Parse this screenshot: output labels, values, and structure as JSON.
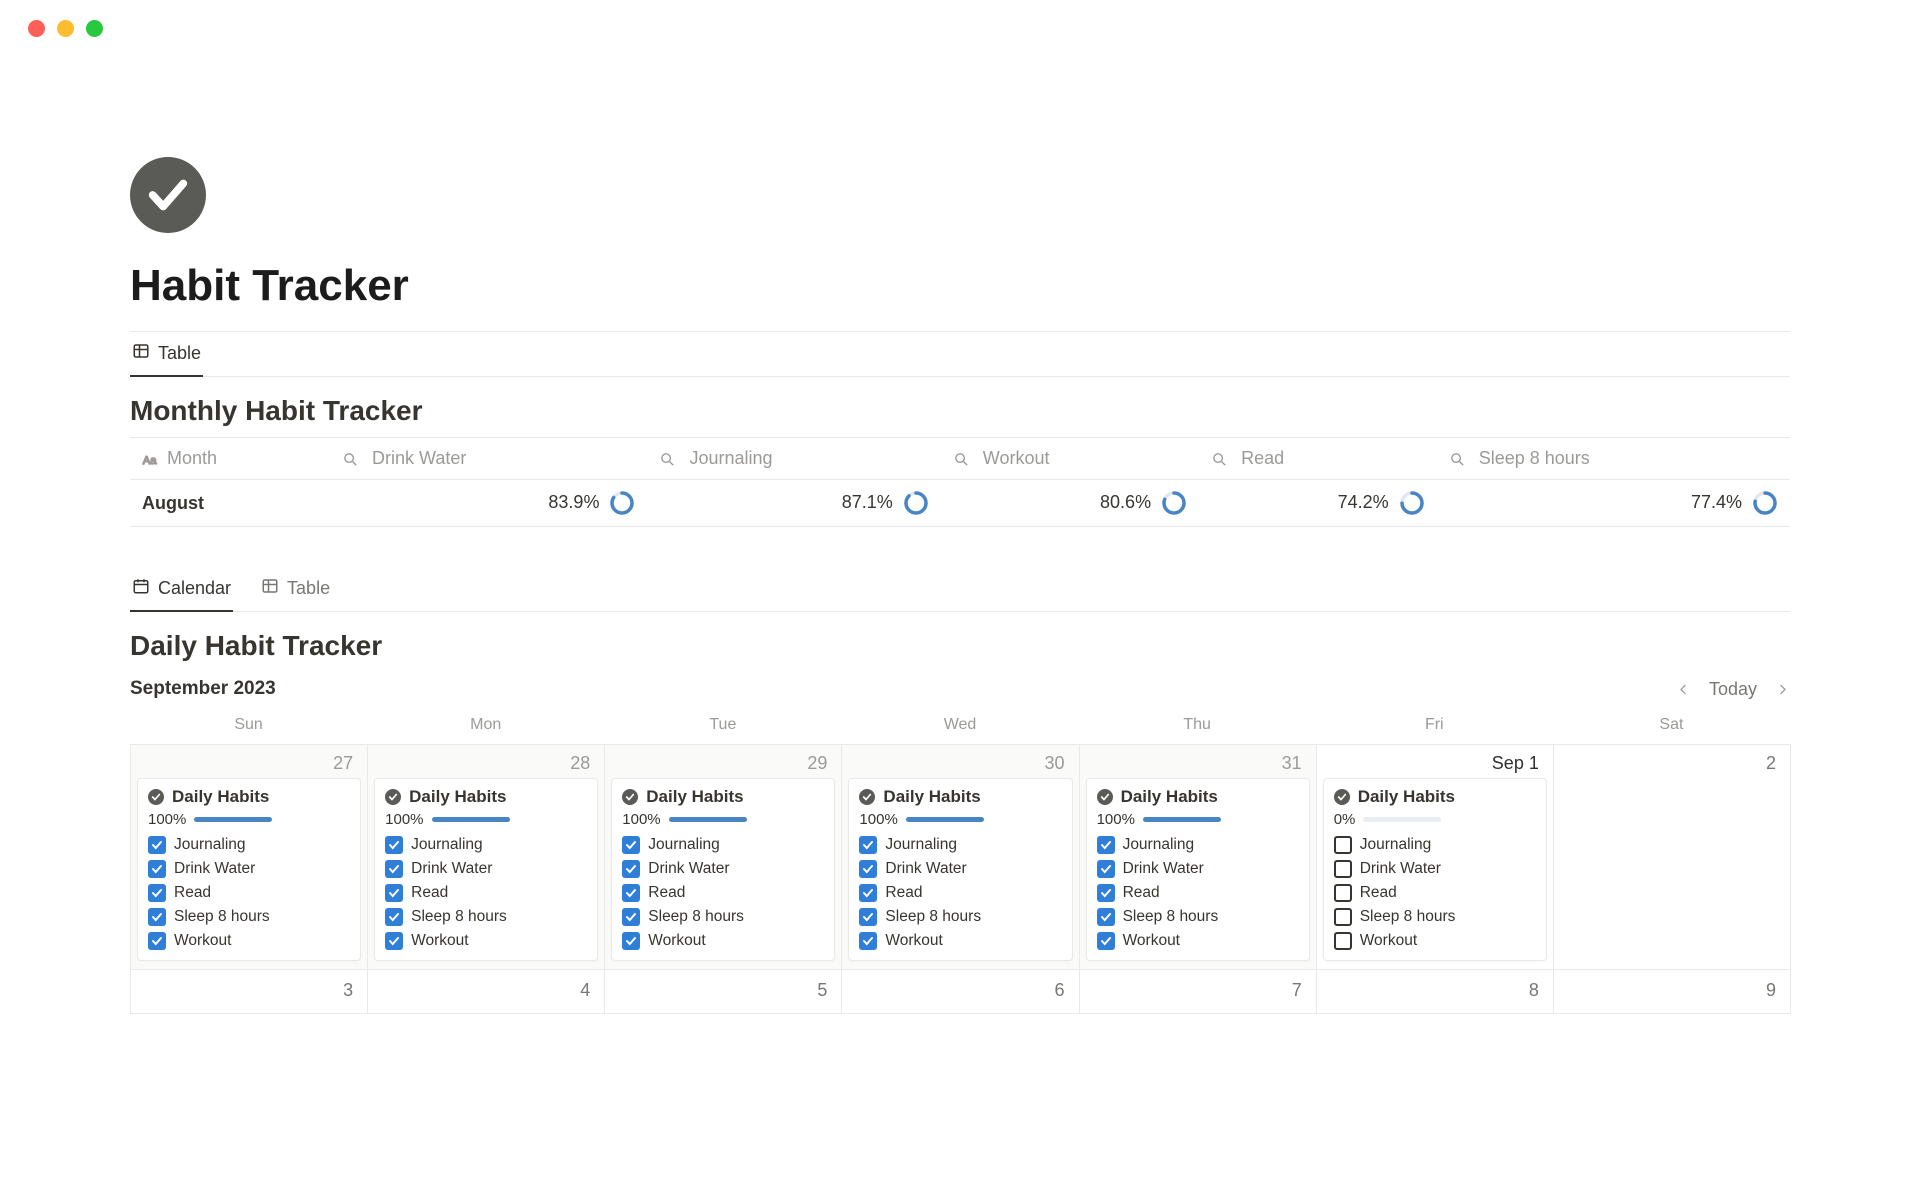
{
  "page": {
    "title": "Habit Tracker"
  },
  "monthly": {
    "tab_table": "Table",
    "title": "Monthly Habit Tracker",
    "col_month": "Month",
    "cols": [
      "Drink Water",
      "Journaling",
      "Workout",
      "Read",
      "Sleep 8 hours"
    ],
    "row": {
      "month": "August",
      "values": [
        "83.9%",
        "87.1%",
        "80.6%",
        "74.2%",
        "77.4%"
      ],
      "pct": [
        83.9,
        87.1,
        80.6,
        74.2,
        77.4
      ]
    }
  },
  "daily": {
    "tab_calendar": "Calendar",
    "tab_table": "Table",
    "title": "Daily Habit Tracker",
    "month_label": "September 2023",
    "today_label": "Today",
    "dow": [
      "Sun",
      "Mon",
      "Tue",
      "Wed",
      "Thu",
      "Fri",
      "Sat"
    ],
    "card_title": "Daily Habits",
    "habits": [
      "Journaling",
      "Drink Water",
      "Read",
      "Sleep 8 hours",
      "Workout"
    ],
    "days_row1": [
      {
        "label": "27",
        "prev": true,
        "progress_text": "100%",
        "progress_pct": 100,
        "checked": true
      },
      {
        "label": "28",
        "prev": true,
        "progress_text": "100%",
        "progress_pct": 100,
        "checked": true
      },
      {
        "label": "29",
        "prev": true,
        "progress_text": "100%",
        "progress_pct": 100,
        "checked": true
      },
      {
        "label": "30",
        "prev": true,
        "progress_text": "100%",
        "progress_pct": 100,
        "checked": true
      },
      {
        "label": "31",
        "prev": true,
        "progress_text": "100%",
        "progress_pct": 100,
        "checked": true
      },
      {
        "label": "Sep 1",
        "prev": false,
        "first": true,
        "progress_text": "0%",
        "progress_pct": 0,
        "checked": false
      },
      {
        "label": "2",
        "prev": false,
        "empty": true
      }
    ],
    "days_row2": [
      "3",
      "4",
      "5",
      "6",
      "7",
      "8",
      "9"
    ]
  },
  "colors": {
    "accent": "#4a85c3",
    "checkbox": "#2f7fd9"
  }
}
